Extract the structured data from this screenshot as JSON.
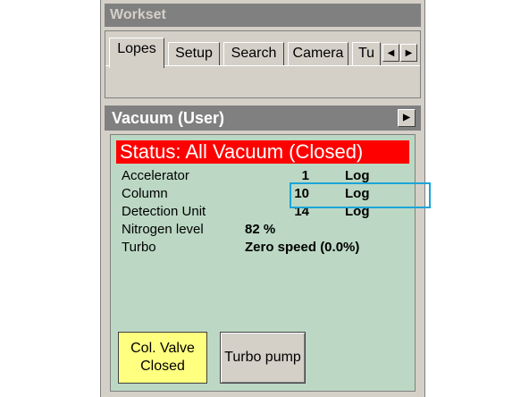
{
  "workset": {
    "title": "Workset",
    "tabs": [
      {
        "label": "Lopes",
        "active": true
      },
      {
        "label": "Setup"
      },
      {
        "label": "Search"
      },
      {
        "label": "Camera"
      },
      {
        "label": "Tu"
      }
    ]
  },
  "vacuum": {
    "title": "Vacuum (User)",
    "status": "Status: All Vacuum (Closed)",
    "rows": [
      {
        "label": "Accelerator",
        "value": "1",
        "unit": "Log"
      },
      {
        "label": "Column",
        "value": "10",
        "unit": "Log"
      },
      {
        "label": "Detection Unit",
        "value": "14",
        "unit": "Log"
      },
      {
        "label": "Nitrogen level",
        "value": "82 %"
      },
      {
        "label": "Turbo",
        "value": "Zero speed (0.0%)"
      }
    ],
    "buttons": {
      "col_valve_line1": "Col. Valve",
      "col_valve_line2": "Closed",
      "turbo_pump": "Turbo pump"
    }
  },
  "colors": {
    "status_bg": "#ff0000",
    "panel_bg": "#bcd8c4",
    "col_valve_bg": "#ffff80",
    "highlight": "#1ba5d8"
  }
}
